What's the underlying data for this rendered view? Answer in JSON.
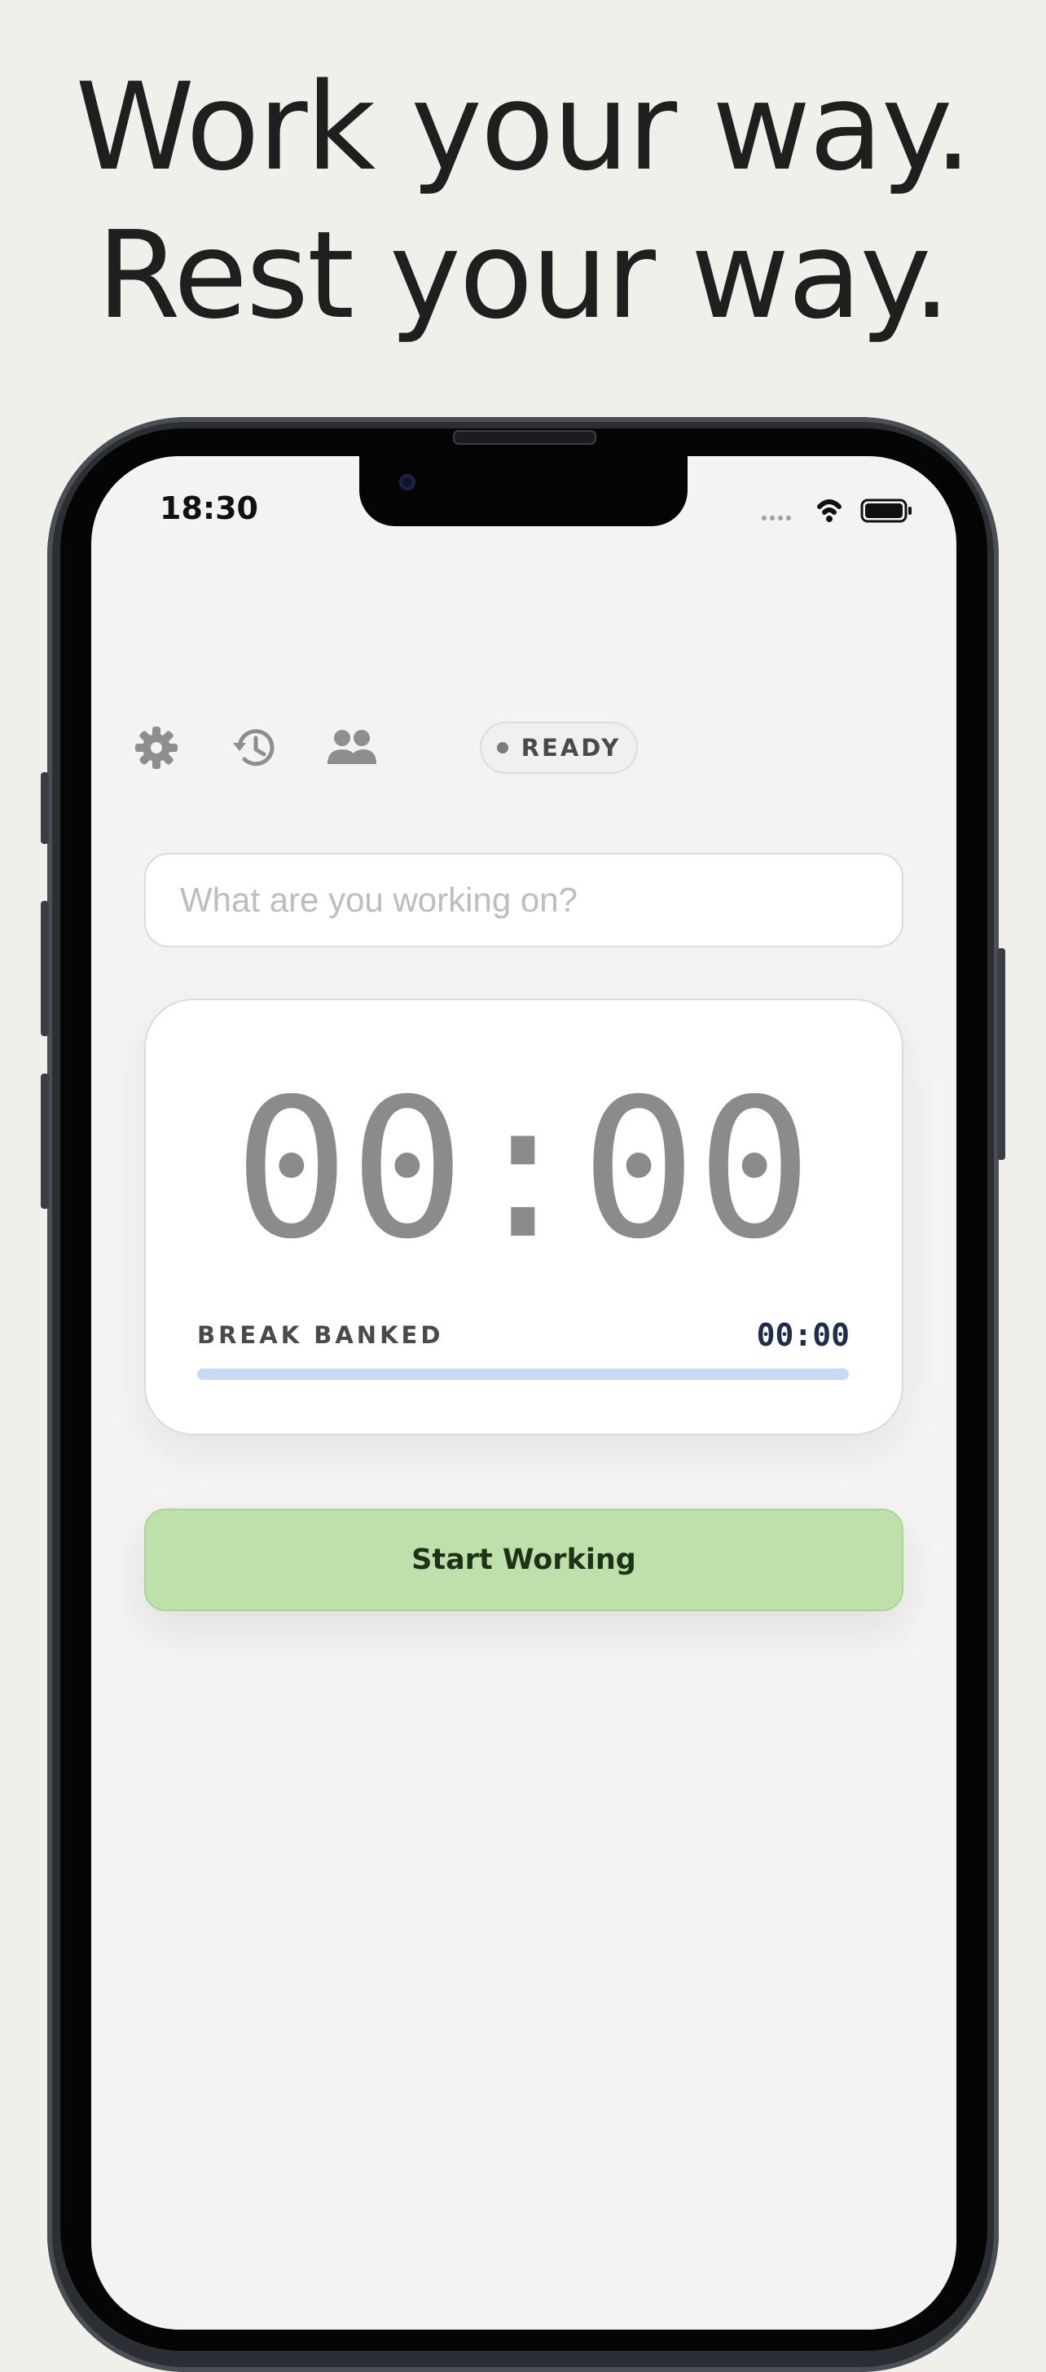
{
  "headline": {
    "line1": "Work your way.",
    "line2": "Rest your way."
  },
  "status_bar": {
    "time": "18:30"
  },
  "toolbar": {
    "icons": [
      "gear-icon",
      "history-icon",
      "people-icon"
    ],
    "status_pill": "READY"
  },
  "task": {
    "placeholder": "What are you working on?",
    "value": ""
  },
  "timer": {
    "display": "00:00"
  },
  "break_bank": {
    "label": "BREAK BANKED",
    "value": "00:00",
    "progress": 1.0
  },
  "start_button": {
    "label": "Start Working"
  },
  "colors": {
    "background": "#f1efe9",
    "screen": "#f4f3f1",
    "accent_green": "#bee1ab",
    "progress_blue": "#c8daf3",
    "timer_gray": "#8b8b8b"
  }
}
